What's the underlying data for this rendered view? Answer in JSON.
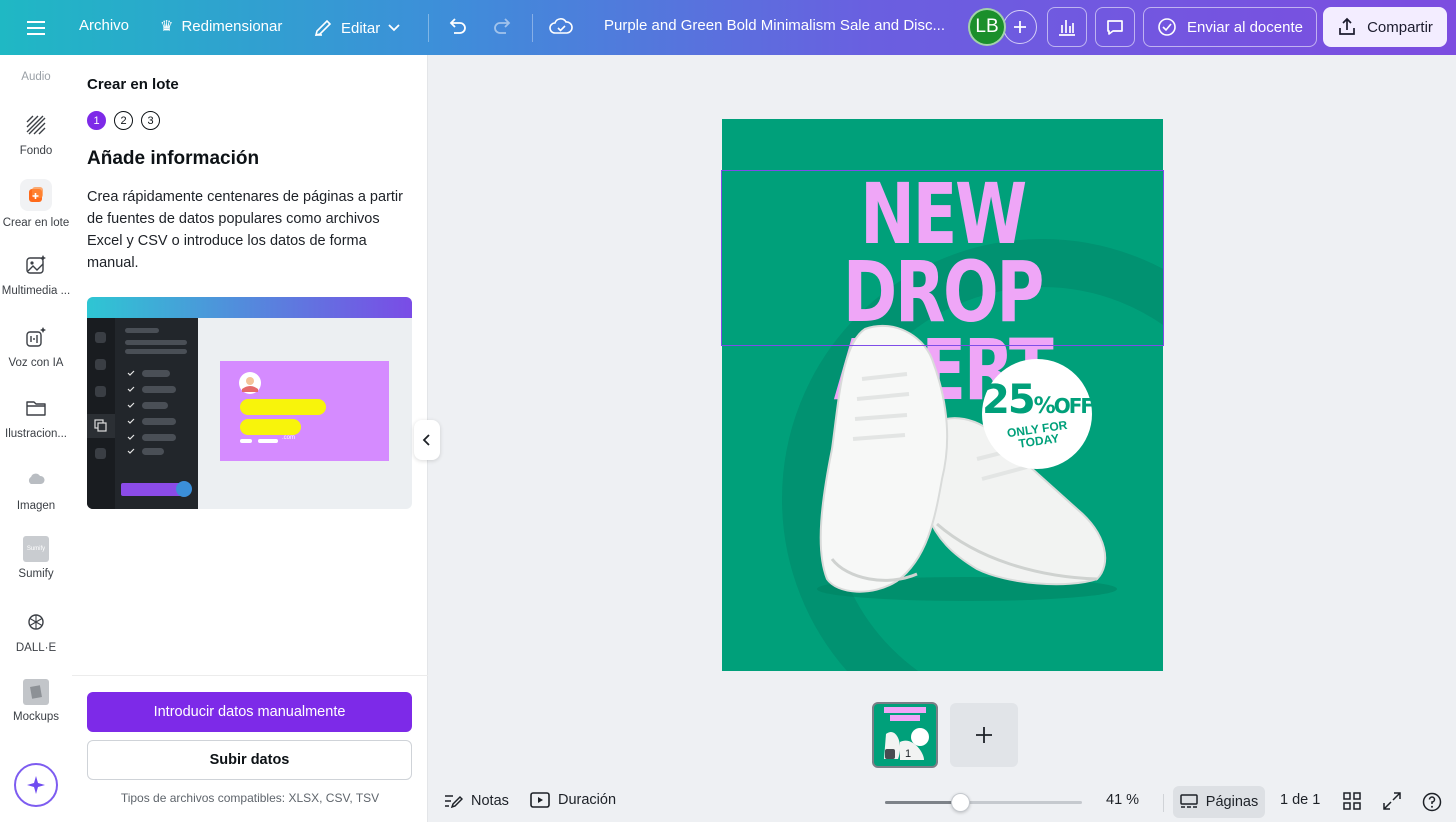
{
  "topbar": {
    "archivo": "Archivo",
    "redimensionar": "Redimensionar",
    "editar": "Editar",
    "doc_title": "Purple and Green Bold Minimalism Sale and Disc...",
    "avatar_initials": "LB",
    "enviar": "Enviar al docente",
    "compartir": "Compartir"
  },
  "rail": {
    "audio": "Audio",
    "items": [
      {
        "label": "Fondo",
        "icon": "background-pattern-icon"
      },
      {
        "label": "Crear en lote",
        "icon": "bulk-create-icon"
      },
      {
        "label": "Multimedia ...",
        "icon": "magic-media-icon"
      },
      {
        "label": "Voz con IA",
        "icon": "ai-voice-icon"
      },
      {
        "label": "Ilustracion...",
        "icon": "folder-icon"
      },
      {
        "label": "Imagen",
        "icon": "cloud-image-icon"
      },
      {
        "label": "Sumify",
        "icon": "sumify-app-icon"
      },
      {
        "label": "DALL·E",
        "icon": "openai-icon"
      },
      {
        "label": "Mockups",
        "icon": "mockups-icon"
      }
    ]
  },
  "panel": {
    "title": "Crear en lote",
    "steps": [
      "1",
      "2",
      "3"
    ],
    "active_step": 1,
    "heading": "Añade información",
    "description": "Crea rápidamente centenares de páginas a partir de fuentes de datos populares como archivos Excel y CSV o introduce los datos de forma manual.",
    "illustration_email": ".com",
    "primary_button": "Introducir datos manualmente",
    "secondary_button": "Subir datos",
    "footnote": "Tipos de archivos compatibles: XLSX, CSV, TSV"
  },
  "design": {
    "headline_line1": "NEW DROP",
    "headline_line2": "ALERT",
    "badge_percent": "25",
    "badge_percent_sign": "%",
    "badge_off": "OFF",
    "badge_sub": "ONLY FOR TODAY",
    "bg_color": "#00a07a",
    "headline_color": "#efa6f7"
  },
  "thumbnail": {
    "page_number": "1"
  },
  "bottombar": {
    "notas": "Notas",
    "duracion": "Duración",
    "zoom": "41 %",
    "zoom_fraction": 0.38,
    "paginas": "Páginas",
    "page_count": "1 de 1"
  }
}
